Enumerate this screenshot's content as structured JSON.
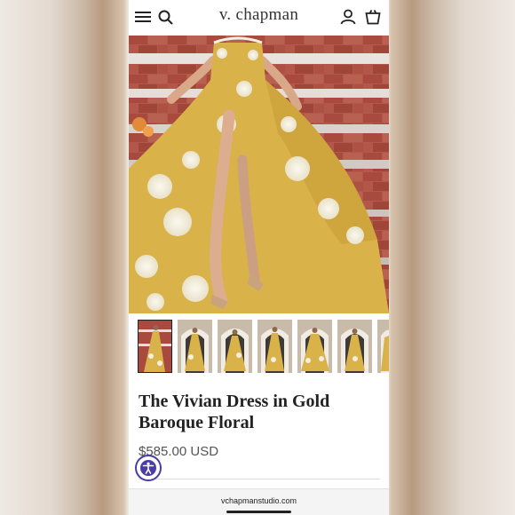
{
  "brand": "v. chapman",
  "header": {
    "menu_icon": "hamburger-menu-icon",
    "search_icon": "search-icon",
    "account_icon": "user-icon",
    "cart_icon": "shopping-bag-icon"
  },
  "product": {
    "title": "The Vivian Dress in Gold Baroque Floral",
    "price": "$585.00 USD",
    "thumbnail_count": 7
  },
  "accessibility_icon": "accessibility-icon",
  "browser": {
    "url": "vchapmanstudio.com"
  },
  "colors": {
    "dress_gold": "#d9b24a",
    "floral_white": "#f3eee0",
    "brick": "#a5493a",
    "accessibility_ring": "#4a3ba7"
  }
}
